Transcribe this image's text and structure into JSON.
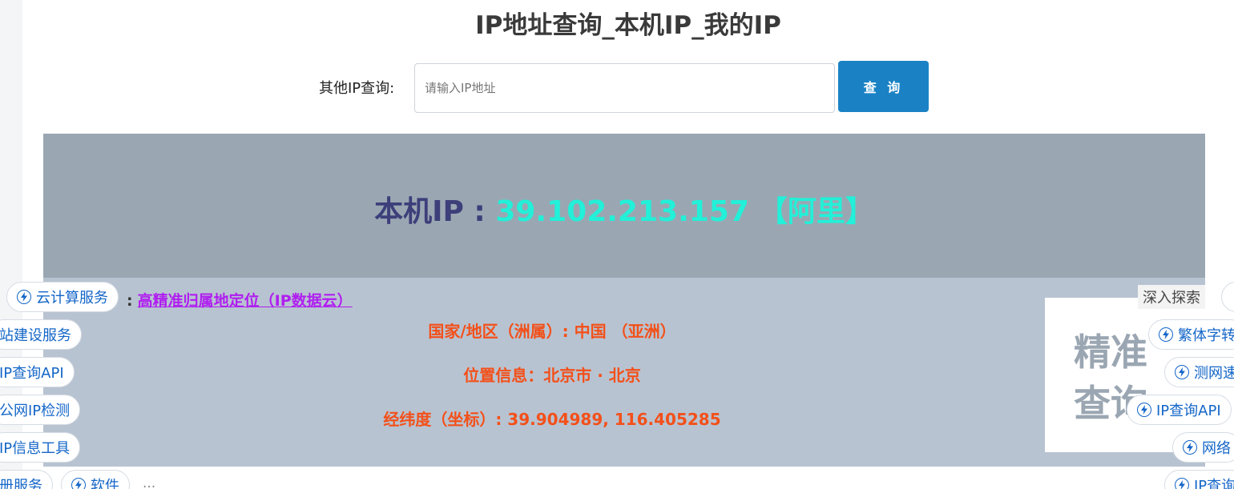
{
  "page": {
    "title": "IP地址查询_本机IP_我的IP"
  },
  "search": {
    "label": "其他IP查询:",
    "placeholder": "请输入IP地址",
    "button_label": "查 询"
  },
  "ip_banner": {
    "label": "本机IP : ",
    "ip": "39.102.213.157",
    "isp": "【阿里】"
  },
  "info": {
    "datasource_prefix": ":",
    "datasource_link": "高精准归属地定位（IP数据云）",
    "country": "国家/地区（洲属）:  中国 （亚洲）",
    "location": "位置信息：北京市 · 北京",
    "coords": "经纬度（坐标）:  39.904989, 116.405285"
  },
  "promo": {
    "line1": "精准",
    "line2": "查询"
  },
  "deep_search": "深入探索",
  "bottom_text": "...",
  "left_pills": [
    {
      "label": "云计算服务",
      "icon": "bolt-icon"
    },
    {
      "label": "站建设服务"
    },
    {
      "label": "IP查询API"
    },
    {
      "label": "公网IP检测"
    },
    {
      "label": "IP信息工具"
    },
    {
      "label": "册服务"
    },
    {
      "label": "软件",
      "icon": "bolt-icon"
    }
  ],
  "right_pills": [
    {
      "label": "繁体字转",
      "icon": "bolt-icon"
    },
    {
      "label": "测网速",
      "icon": "bolt-icon"
    },
    {
      "label": "IP查询API",
      "icon": "bolt-icon"
    },
    {
      "label": "网络",
      "icon": "bolt-icon"
    },
    {
      "label": "IP查询",
      "icon": "bolt-icon"
    }
  ],
  "colors": {
    "accent_button": "#1a82c4",
    "banner_bg": "#9aa7b3",
    "info_bg": "#b8c3d1",
    "ip_value": "#22f0d8",
    "info_text": "#f3501a",
    "link": "#b01ef0",
    "pill_text": "#1466c8"
  }
}
